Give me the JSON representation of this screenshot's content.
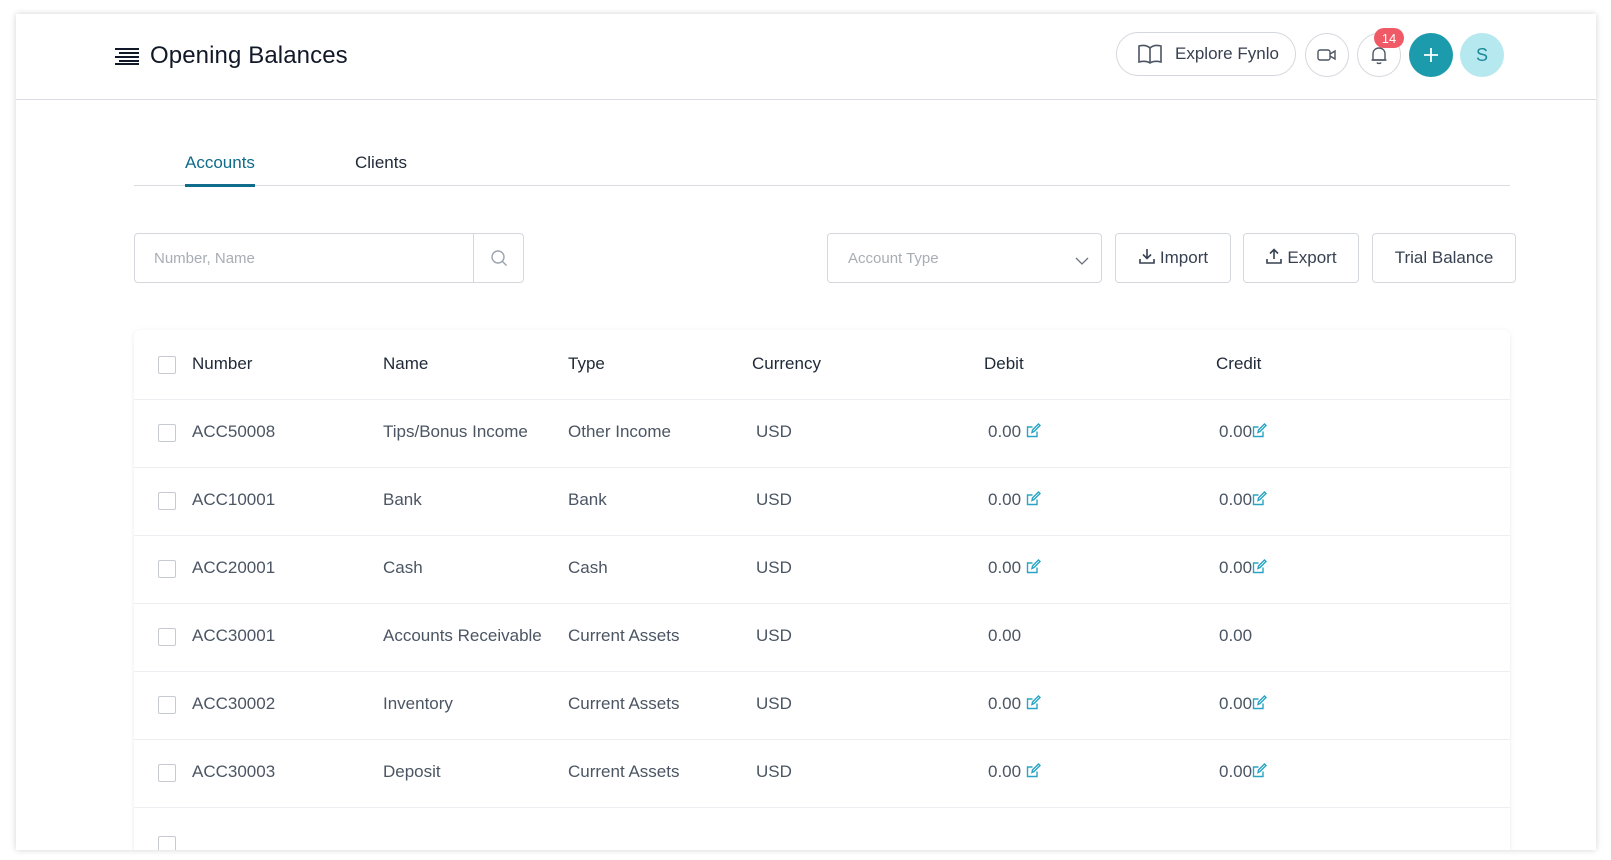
{
  "header": {
    "title": "Opening Balances",
    "explore_label": "Explore Fynlo",
    "notification_count": "14",
    "avatar_initial": "S"
  },
  "tabs": [
    {
      "label": "Accounts",
      "active": true
    },
    {
      "label": "Clients",
      "active": false
    }
  ],
  "toolbar": {
    "search_placeholder": "Number, Name",
    "account_type_placeholder": "Account Type",
    "import_label": "Import",
    "export_label": "Export",
    "trial_balance_label": "Trial Balance"
  },
  "table": {
    "columns": [
      "Number",
      "Name",
      "Type",
      "Currency",
      "Debit",
      "Credit"
    ],
    "rows": [
      {
        "number": "ACC50008",
        "name": "Tips/Bonus Income",
        "type": "Other Income",
        "currency": "USD",
        "debit": "0.00",
        "credit": "0.00",
        "editable": true
      },
      {
        "number": "ACC10001",
        "name": "Bank",
        "type": "Bank",
        "currency": "USD",
        "debit": "0.00",
        "credit": "0.00",
        "editable": true
      },
      {
        "number": "ACC20001",
        "name": "Cash",
        "type": "Cash",
        "currency": "USD",
        "debit": "0.00",
        "credit": "0.00",
        "editable": true
      },
      {
        "number": "ACC30001",
        "name": "Accounts Receivable",
        "type": "Current Assets",
        "currency": "USD",
        "debit": "0.00",
        "credit": "0.00",
        "editable": false
      },
      {
        "number": "ACC30002",
        "name": "Inventory",
        "type": "Current Assets",
        "currency": "USD",
        "debit": "0.00",
        "credit": "0.00",
        "editable": true
      },
      {
        "number": "ACC30003",
        "name": "Deposit",
        "type": "Current Assets",
        "currency": "USD",
        "debit": "0.00",
        "credit": "0.00",
        "editable": true
      }
    ]
  },
  "colors": {
    "accent": "#0f6c8a",
    "primary_button": "#1b9bab",
    "badge": "#f05a67",
    "avatar_bg": "#b6e8ef",
    "edit_icon": "#2aa3c4"
  },
  "icons": {
    "menu": "menu-lines-icon",
    "explore": "open-book-icon",
    "video": "video-camera-icon",
    "bell": "bell-icon",
    "add": "plus-icon",
    "search": "search-icon",
    "select": "chevron-down-icon",
    "import": "download-icon",
    "export": "upload-icon",
    "edit": "edit-icon"
  }
}
